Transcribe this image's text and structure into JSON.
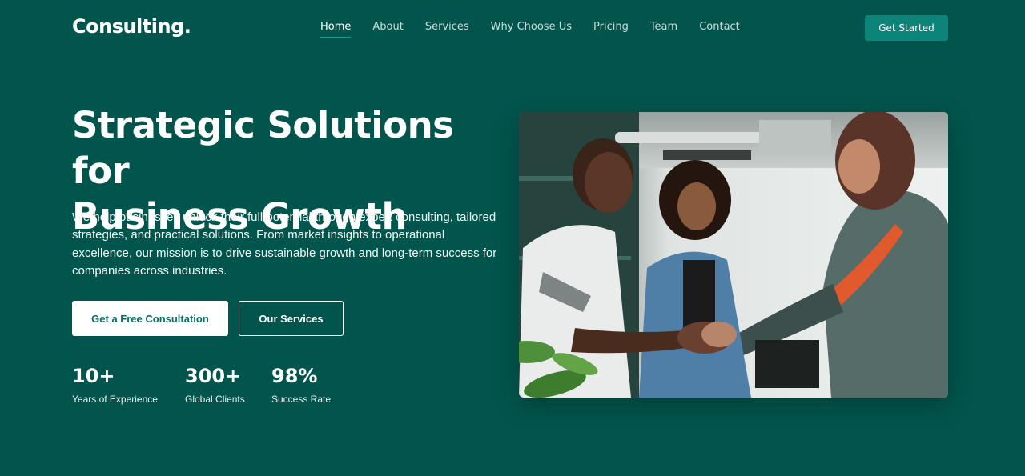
{
  "header": {
    "logo": "Consulting.",
    "nav": [
      {
        "label": "Home",
        "active": true
      },
      {
        "label": "About"
      },
      {
        "label": "Services"
      },
      {
        "label": "Why Choose Us"
      },
      {
        "label": "Pricing"
      },
      {
        "label": "Team"
      },
      {
        "label": "Contact"
      }
    ],
    "cta_label": "Get Started"
  },
  "hero": {
    "headline_line1": "Strategic Solutions for",
    "headline_line2": "Business Growth",
    "description": "We help businesses unlock their full potential through expert consulting, tailored strategies, and practical solutions. From market insights to operational excellence, our mission is to drive sustainable growth and long-term success for companies across industries.",
    "primary_button": "Get a Free Consultation",
    "secondary_button": "Our Services",
    "stats": [
      {
        "value": "10+",
        "label": "Years of Experience"
      },
      {
        "value": "300+",
        "label": "Global Clients"
      },
      {
        "value": "98%",
        "label": "Success Rate"
      }
    ]
  },
  "colors": {
    "background": "#02554c",
    "accent": "#0d8479",
    "primary_button_text": "#0b6f64"
  }
}
